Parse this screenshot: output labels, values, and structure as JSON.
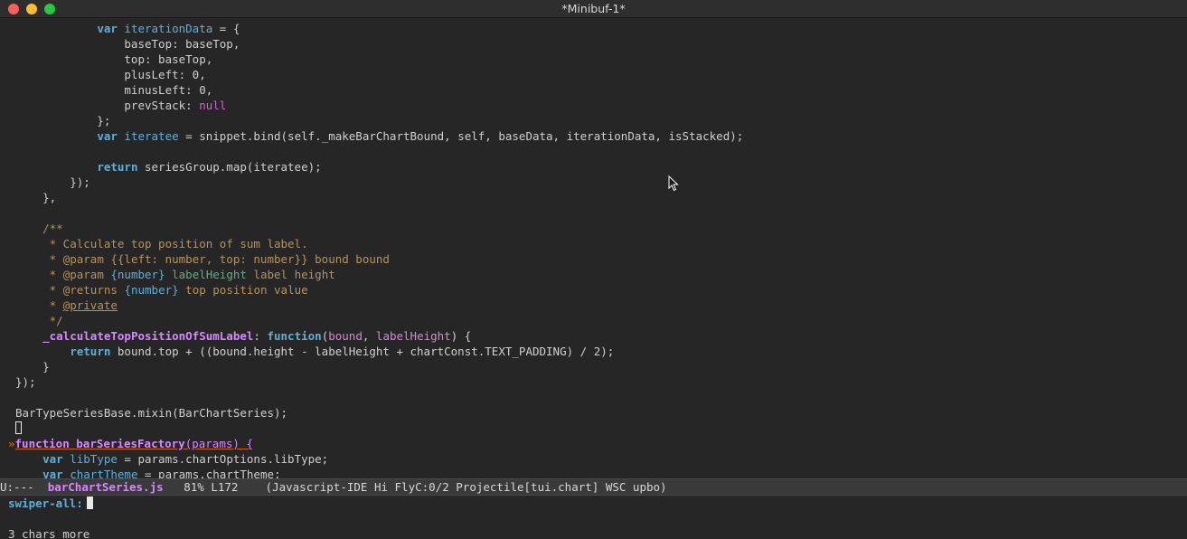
{
  "window": {
    "title": "*Minibuf-1*"
  },
  "editor": {
    "lines": [
      {
        "segments": [
          {
            "t": "            ",
            "c": ""
          },
          {
            "t": "var",
            "c": "kw"
          },
          {
            "t": " ",
            "c": ""
          },
          {
            "t": "iterationData",
            "c": "def"
          },
          {
            "t": " = {",
            "c": ""
          }
        ]
      },
      {
        "segments": [
          {
            "t": "                baseTop: baseTop,",
            "c": ""
          }
        ]
      },
      {
        "segments": [
          {
            "t": "                top: baseTop,",
            "c": ""
          }
        ]
      },
      {
        "segments": [
          {
            "t": "                plusLeft: 0,",
            "c": ""
          }
        ]
      },
      {
        "segments": [
          {
            "t": "                minusLeft: 0,",
            "c": ""
          }
        ]
      },
      {
        "segments": [
          {
            "t": "                prevStack: ",
            "c": ""
          },
          {
            "t": "null",
            "c": "val"
          }
        ]
      },
      {
        "segments": [
          {
            "t": "            };",
            "c": ""
          }
        ]
      },
      {
        "segments": [
          {
            "t": "            ",
            "c": ""
          },
          {
            "t": "var",
            "c": "kw"
          },
          {
            "t": " ",
            "c": ""
          },
          {
            "t": "iteratee",
            "c": "def"
          },
          {
            "t": " = snippet.bind(self._makeBarChartBound, self, baseData, iterationData, isStacked);",
            "c": ""
          }
        ]
      },
      {
        "segments": [
          {
            "t": "",
            "c": ""
          }
        ]
      },
      {
        "segments": [
          {
            "t": "            ",
            "c": ""
          },
          {
            "t": "return",
            "c": "kw"
          },
          {
            "t": " seriesGroup.map(iteratee);",
            "c": ""
          }
        ]
      },
      {
        "segments": [
          {
            "t": "        });",
            "c": ""
          }
        ]
      },
      {
        "segments": [
          {
            "t": "    },",
            "c": ""
          }
        ]
      },
      {
        "segments": [
          {
            "t": "",
            "c": ""
          }
        ]
      },
      {
        "segments": [
          {
            "t": "    /**",
            "c": "cmt"
          }
        ]
      },
      {
        "segments": [
          {
            "t": "     * Calculate top position of sum label.",
            "c": "cmt"
          }
        ]
      },
      {
        "segments": [
          {
            "t": "     * ",
            "c": "cmt"
          },
          {
            "t": "@param",
            "c": "doctag"
          },
          {
            "t": " {{left: number, top: number}} bound bound",
            "c": "cmt"
          }
        ]
      },
      {
        "segments": [
          {
            "t": "     * ",
            "c": "cmt"
          },
          {
            "t": "@param",
            "c": "doctag"
          },
          {
            "t": " ",
            "c": "cmt"
          },
          {
            "t": "{number}",
            "c": "doctype"
          },
          {
            "t": " ",
            "c": "cmt"
          },
          {
            "t": "labelHeight",
            "c": "docvar"
          },
          {
            "t": " label height",
            "c": "cmt"
          }
        ]
      },
      {
        "segments": [
          {
            "t": "     * ",
            "c": "cmt"
          },
          {
            "t": "@returns",
            "c": "doctag"
          },
          {
            "t": " ",
            "c": "cmt"
          },
          {
            "t": "{number}",
            "c": "doctype"
          },
          {
            "t": " top position value",
            "c": "cmt"
          }
        ]
      },
      {
        "segments": [
          {
            "t": "     * ",
            "c": "cmt"
          },
          {
            "t": "@private",
            "c": "doctag uline"
          }
        ]
      },
      {
        "segments": [
          {
            "t": "     */",
            "c": "cmt"
          }
        ]
      },
      {
        "segments": [
          {
            "t": "    ",
            "c": ""
          },
          {
            "t": "_calculateTopPositionOfSumLabel",
            "c": "fn"
          },
          {
            "t": ": ",
            "c": ""
          },
          {
            "t": "function",
            "c": "kw"
          },
          {
            "t": "(",
            "c": ""
          },
          {
            "t": "bound",
            "c": "param"
          },
          {
            "t": ", ",
            "c": ""
          },
          {
            "t": "labelHeight",
            "c": "param"
          },
          {
            "t": ") {",
            "c": ""
          }
        ]
      },
      {
        "segments": [
          {
            "t": "        ",
            "c": ""
          },
          {
            "t": "return",
            "c": "kw"
          },
          {
            "t": " bound.top + ((bound.height - labelHeight + chartConst.TEXT_PADDING) / 2);",
            "c": ""
          }
        ]
      },
      {
        "segments": [
          {
            "t": "    }",
            "c": ""
          }
        ]
      },
      {
        "segments": [
          {
            "t": "});",
            "c": ""
          }
        ]
      },
      {
        "segments": [
          {
            "t": "",
            "c": ""
          }
        ]
      },
      {
        "segments": [
          {
            "t": "BarTypeSeriesBase.mixin(BarChartSeries);",
            "c": ""
          }
        ]
      },
      {
        "segments": [
          {
            "t": "",
            "c": "cursorbox"
          }
        ]
      },
      {
        "segments": [
          {
            "t": "»",
            "c": "arrow"
          },
          {
            "t": "function",
            "c": "kw hl-line"
          },
          {
            "t": " ",
            "c": "hl-line"
          },
          {
            "t": "barSeriesFactory",
            "c": "fn hl-line"
          },
          {
            "t": "(",
            "c": "hl-line"
          },
          {
            "t": "params",
            "c": "param hl-line"
          },
          {
            "t": ") {",
            "c": "hl-line"
          }
        ]
      },
      {
        "segments": [
          {
            "t": "    ",
            "c": ""
          },
          {
            "t": "var",
            "c": "kw"
          },
          {
            "t": " ",
            "c": ""
          },
          {
            "t": "libType",
            "c": "def"
          },
          {
            "t": " = params.chartOptions.libType;",
            "c": ""
          }
        ]
      },
      {
        "segments": [
          {
            "t": "    ",
            "c": ""
          },
          {
            "t": "var",
            "c": "kw"
          },
          {
            "t": " ",
            "c": ""
          },
          {
            "t": "chartTheme",
            "c": "def"
          },
          {
            "t": " = params.chartTheme;",
            "c": ""
          }
        ]
      }
    ]
  },
  "modeline": {
    "status": "U:---",
    "buffer_name": "barChartSeries.js",
    "position": "81% L172",
    "modes": "(Javascript-IDE Hi FlyC:0/2 Projectile[tui.chart] WSC upbo)"
  },
  "minibuffer": {
    "prompt": "swiper-all:",
    "input_value": "",
    "hint": "3 chars more"
  },
  "colors": {
    "background": "#262626",
    "keyword": "#5fafd7",
    "function_name": "#d787ff",
    "comment": "#b4935f",
    "null_value": "#d75fd7",
    "modeline_bg": "#3a3a3a"
  }
}
